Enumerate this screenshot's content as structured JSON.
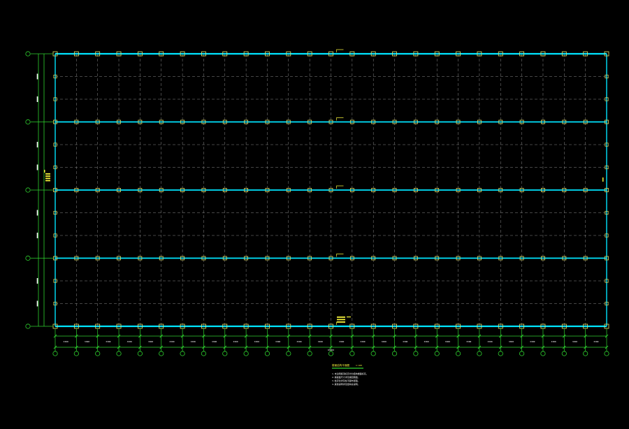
{
  "drawing": {
    "background": "#000000",
    "colors": {
      "grid_dashed": "#8a8a8a",
      "main_beam": "#00e5ff",
      "column": "#e6e36a",
      "dimension": "#2fd12f",
      "annotation": "#f2ef3a",
      "axis_bubble": "#2fd12f"
    },
    "counts": {
      "axis_columns": 27,
      "axis_rows": 5,
      "sub_rows_per_bay": 2,
      "edge_columns_per_bay": 2
    },
    "legend_title": "楼面结构平面图",
    "legend_scale": "1:100",
    "notes": [
      "1.未注明梁顶标高均为结构楼面标高。",
      "  2.梁截面尺寸详见梁配筋图。",
      "  3.柱定位详见柱平面布置图。",
      "  4.其他说明详见结构总说明。"
    ],
    "total_dimension": "85500",
    "bay_dimensions": [
      "3300",
      "3300",
      "3300",
      "3300",
      "3300",
      "3300",
      "3300",
      "3300",
      "3300",
      "3300",
      "3300",
      "3300",
      "3300",
      "3300",
      "3300",
      "3300",
      "3300",
      "3300",
      "3300",
      "3300",
      "3300",
      "3300",
      "3300",
      "3300",
      "3300",
      "3300"
    ]
  }
}
